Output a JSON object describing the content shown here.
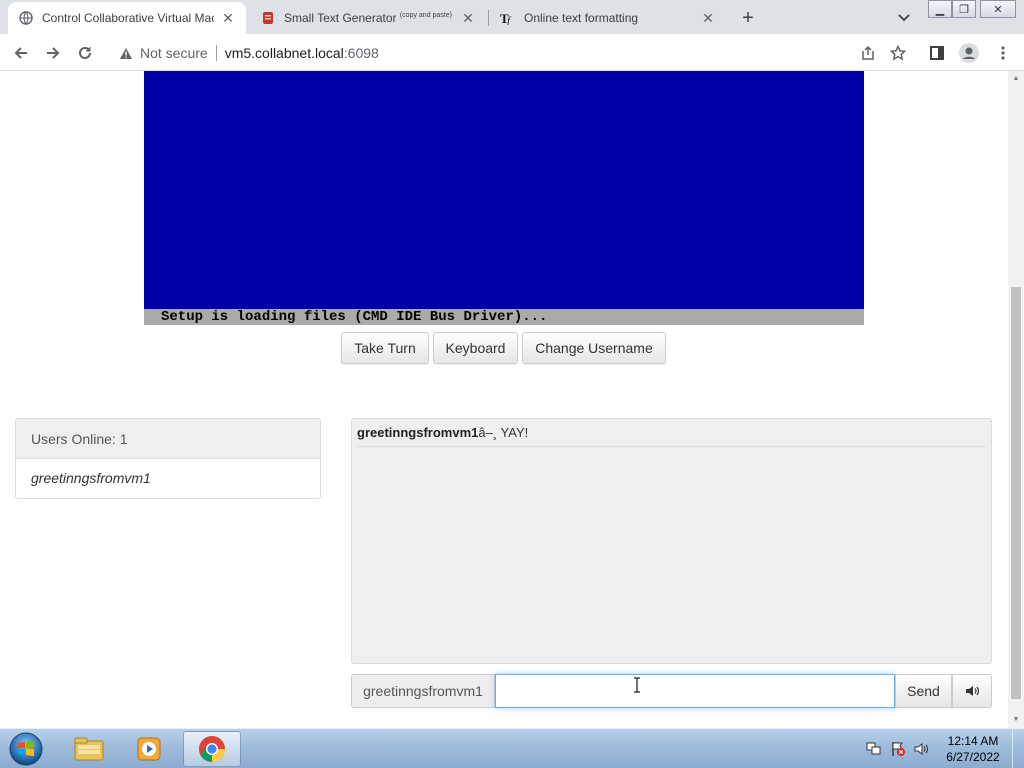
{
  "browser": {
    "tabs": [
      {
        "title": "Control Collaborative Virtual Mac",
        "favicon": "globe-icon",
        "active": true
      },
      {
        "title": "Small Text Generator",
        "title_sup": "(copy and paste)",
        "favicon": "generator-icon",
        "active": false
      },
      {
        "title": "Online text formatting",
        "favicon": "tf-icon",
        "active": false
      }
    ],
    "address": {
      "security_label": "Not secure",
      "host": "vm5.collabnet.local",
      "port": ":6098"
    }
  },
  "vm": {
    "screen_color": "#0000a8",
    "status_text": "Setup is loading files (CMD IDE Bus Driver)..."
  },
  "controls": {
    "take_turn": "Take Turn",
    "keyboard": "Keyboard",
    "change_username": "Change Username"
  },
  "users": {
    "header": "Users Online: 1",
    "list": [
      "greetinngsfromvm1"
    ]
  },
  "chat": {
    "messages": [
      {
        "user": "greetinngsfromvm1",
        "text": "â–¸ YAY!"
      }
    ],
    "username_addon": "greetinngsfromvm1",
    "input_value": "",
    "send_label": "Send",
    "sound_icon": "speaker-icon"
  },
  "taskbar": {
    "apps": [
      "windows-explorer-icon",
      "media-player-icon",
      "chrome-icon"
    ],
    "time": "12:14 AM",
    "date": "6/27/2022"
  }
}
